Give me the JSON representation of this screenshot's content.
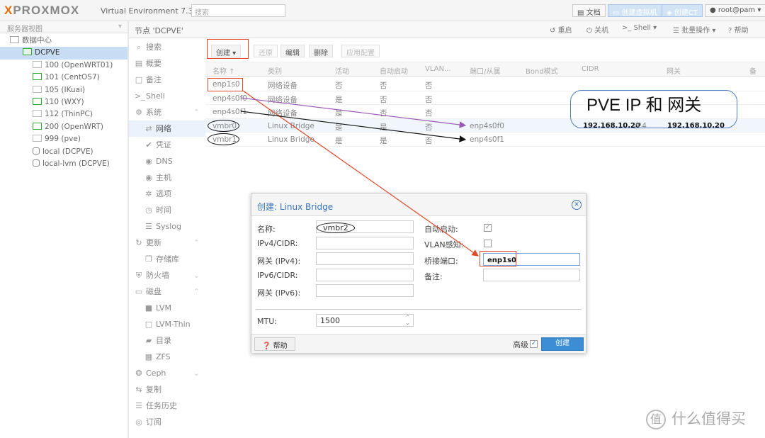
{
  "topbar": {
    "logo_x": "X",
    "logo_rest": "PROXMOX",
    "version": "Virtual Environment 7.3-4",
    "search_placeholder": "搜索",
    "docs": "文档",
    "create_vm": "创建虚拟机",
    "create_ct": "创建CT",
    "user": "root@pam"
  },
  "left": {
    "view": "服务器视图",
    "items": [
      {
        "label": "数据中心"
      },
      {
        "label": "DCPVE"
      },
      {
        "label": "100 (OpenWRT01)"
      },
      {
        "label": "101 (CentOS7)"
      },
      {
        "label": "105 (IKuai)"
      },
      {
        "label": "110 (WXY)"
      },
      {
        "label": "112 (ThinPC)"
      },
      {
        "label": "200 (OpenWRT)"
      },
      {
        "label": "999 (pve)"
      },
      {
        "label": "local (DCPVE)"
      },
      {
        "label": "local-lvm (DCPVE)"
      }
    ]
  },
  "node": {
    "title": "节点 'DCPVE'",
    "reboot": "重启",
    "shutdown": "关机",
    "shell": "Shell",
    "bulk": "批量操作",
    "help": "帮助"
  },
  "menu": [
    {
      "label": "搜索",
      "icon": "search-icon"
    },
    {
      "label": "概要",
      "icon": "summary-icon"
    },
    {
      "label": "备注",
      "icon": "notes-icon"
    },
    {
      "label": "Shell",
      "icon": "terminal-icon"
    },
    {
      "label": "系统",
      "icon": "gears-icon"
    },
    {
      "label": "网络",
      "icon": "network-icon"
    },
    {
      "label": "凭证",
      "icon": "certificate-icon"
    },
    {
      "label": "DNS",
      "icon": "globe-icon"
    },
    {
      "label": "主机",
      "icon": "globe-icon"
    },
    {
      "label": "选项",
      "icon": "gear-icon"
    },
    {
      "label": "时间",
      "icon": "clock-icon"
    },
    {
      "label": "Syslog",
      "icon": "list-icon"
    },
    {
      "label": "更新",
      "icon": "refresh-icon"
    },
    {
      "label": "存储库",
      "icon": "files-icon"
    },
    {
      "label": "防火墙",
      "icon": "shield-icon"
    },
    {
      "label": "磁盘",
      "icon": "disk-icon"
    },
    {
      "label": "LVM",
      "icon": "square-icon"
    },
    {
      "label": "LVM-Thin",
      "icon": "square-icon"
    },
    {
      "label": "目录",
      "icon": "folder-icon"
    },
    {
      "label": "ZFS",
      "icon": "grid-icon"
    },
    {
      "label": "Ceph",
      "icon": "ceph-icon"
    },
    {
      "label": "复制",
      "icon": "retweet-icon"
    },
    {
      "label": "任务历史",
      "icon": "list-icon"
    },
    {
      "label": "订阅",
      "icon": "support-icon"
    }
  ],
  "grid": {
    "toolbar": {
      "create": "创建",
      "revert": "还原",
      "edit": "编辑",
      "delete": "删除",
      "apply": "应用配置"
    },
    "columns": [
      "名称 ↑",
      "类别",
      "活动",
      "自动启动",
      "VLAN...",
      "端口/从属",
      "Bond模式",
      "CIDR",
      "网关",
      "备"
    ],
    "rows": [
      {
        "name": "enp1s0",
        "type": "网络设备",
        "active": "否",
        "autostart": "否",
        "vlan": "否",
        "ports": "",
        "bond": "",
        "cidr": "",
        "cidr_suffix": "",
        "gateway": ""
      },
      {
        "name": "enp4s0f0",
        "type": "网络设备",
        "active": "是",
        "autostart": "否",
        "vlan": "否",
        "ports": "",
        "bond": "",
        "cidr": "",
        "cidr_suffix": "",
        "gateway": ""
      },
      {
        "name": "enp4s0f1",
        "type": "网络设备",
        "active": "是",
        "autostart": "否",
        "vlan": "否",
        "ports": "",
        "bond": "",
        "cidr": "",
        "cidr_suffix": "",
        "gateway": ""
      },
      {
        "name": "vmbr0",
        "type": "Linux Bridge",
        "active": "是",
        "autostart": "是",
        "vlan": "否",
        "ports": "enp4s0f0",
        "bond": "",
        "cidr": "192.168.10.20",
        "cidr_suffix": "/24",
        "gateway": "192.168.10.20"
      },
      {
        "name": "vmbr1",
        "type": "Linux Bridge",
        "active": "是",
        "autostart": "是",
        "vlan": "否",
        "ports": "enp4s0f1",
        "bond": "",
        "cidr": "",
        "cidr_suffix": "",
        "gateway": ""
      }
    ]
  },
  "annotation": {
    "text": "PVE IP 和 网关"
  },
  "dialog": {
    "title": "创建: Linux Bridge",
    "name_label": "名称:",
    "name_value": "vmbr2",
    "ipv4_label": "IPv4/CIDR:",
    "gw4_label": "网关 (IPv4):",
    "ipv6_label": "IPv6/CIDR:",
    "gw6_label": "网关 (IPv6):",
    "autostart_label": "自动启动:",
    "vlan_label": "VLAN感知:",
    "ports_label": "桥接端口:",
    "ports_value": "enp1s0",
    "comment_label": "备注:",
    "mtu_label": "MTU:",
    "mtu_value": "1500",
    "help": "帮助",
    "advanced": "高级",
    "create": "创建"
  },
  "watermark": {
    "logo": "值",
    "text": "什么值得买"
  }
}
